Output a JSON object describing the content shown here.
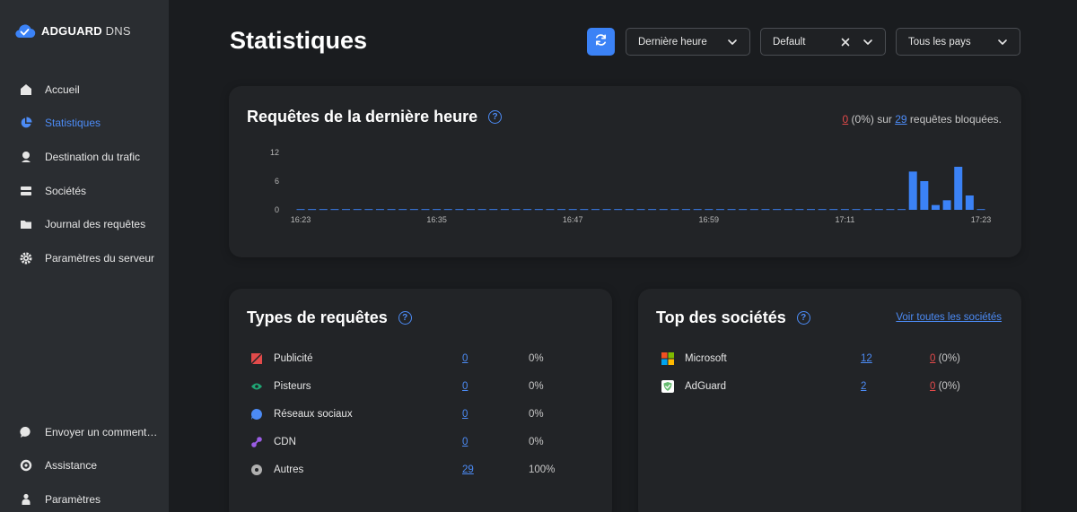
{
  "app": {
    "logo_bold": "ADGUARD",
    "logo_light": " DNS"
  },
  "sidebar": {
    "items": [
      {
        "label": "Accueil",
        "icon": "home-icon"
      },
      {
        "label": "Statistiques",
        "icon": "pie-chart-icon",
        "active": true
      },
      {
        "label": "Destination du trafic",
        "icon": "location-pin-icon"
      },
      {
        "label": "Sociétés",
        "icon": "building-icon"
      },
      {
        "label": "Journal des requêtes",
        "icon": "folder-icon"
      },
      {
        "label": "Paramètres du serveur",
        "icon": "gear-icon"
      }
    ],
    "bottom_items": [
      {
        "label": "Envoyer un comment…",
        "icon": "chat-bubble-icon"
      },
      {
        "label": "Assistance",
        "icon": "lifebuoy-icon"
      },
      {
        "label": "Paramètres",
        "icon": "user-icon"
      }
    ]
  },
  "header": {
    "title": "Statistiques",
    "time_filter": "Dernière heure",
    "server_filter": "Default",
    "country_filter": "Tous les pays"
  },
  "requests_card": {
    "title": "Requêtes de la dernière heure",
    "blocked_count": "0",
    "blocked_pct": " (0%) sur ",
    "total_count": "29",
    "suffix": " requêtes bloquées."
  },
  "chart_data": {
    "type": "bar",
    "title": "Requêtes de la dernière heure",
    "x_tick_labels": [
      "16:23",
      "16:35",
      "16:47",
      "16:59",
      "17:11",
      "17:23"
    ],
    "y_tick_labels": [
      "12",
      "6",
      "0"
    ],
    "ylim": [
      0,
      12
    ],
    "minutes": 61,
    "values": [
      0,
      0,
      0,
      0,
      0,
      0,
      0,
      0,
      0,
      0,
      0,
      0,
      0,
      0,
      0,
      0,
      0,
      0,
      0,
      0,
      0,
      0,
      0,
      0,
      0,
      0,
      0,
      0,
      0,
      0,
      0,
      0,
      0,
      0,
      0,
      0,
      0,
      0,
      0,
      0,
      0,
      0,
      0,
      0,
      0,
      0,
      0,
      0,
      0,
      0,
      0,
      0,
      0,
      0,
      8,
      6,
      1,
      2,
      9,
      3,
      0
    ],
    "bar_color": "#3b82f6",
    "baseline_color": "#3b82f6"
  },
  "types_card": {
    "title": "Types de requêtes",
    "rows": [
      {
        "label": "Publicité",
        "count": "0",
        "pct": "0%",
        "icon": "ad-block-icon",
        "color": "#e24a4a"
      },
      {
        "label": "Pisteurs",
        "count": "0",
        "pct": "0%",
        "icon": "eye-icon",
        "color": "#1fa775"
      },
      {
        "label": "Réseaux sociaux",
        "count": "0",
        "pct": "0%",
        "icon": "social-bubble-icon",
        "color": "#4c8bf5"
      },
      {
        "label": "CDN",
        "count": "0",
        "pct": "0%",
        "icon": "cdn-icon",
        "color": "#9b5de5"
      },
      {
        "label": "Autres",
        "count": "29",
        "pct": "100%",
        "icon": "other-icon",
        "color": "#b0b0b0"
      }
    ]
  },
  "companies_card": {
    "title": "Top des sociétés",
    "see_all": "Voir toutes les sociétés",
    "rows": [
      {
        "label": "Microsoft",
        "count": "12",
        "blocked": "0",
        "blocked_pct": " (0%)",
        "icon": "microsoft-logo-icon"
      },
      {
        "label": "AdGuard",
        "count": "2",
        "blocked": "0",
        "blocked_pct": " (0%)",
        "icon": "adguard-logo-icon"
      }
    ]
  }
}
